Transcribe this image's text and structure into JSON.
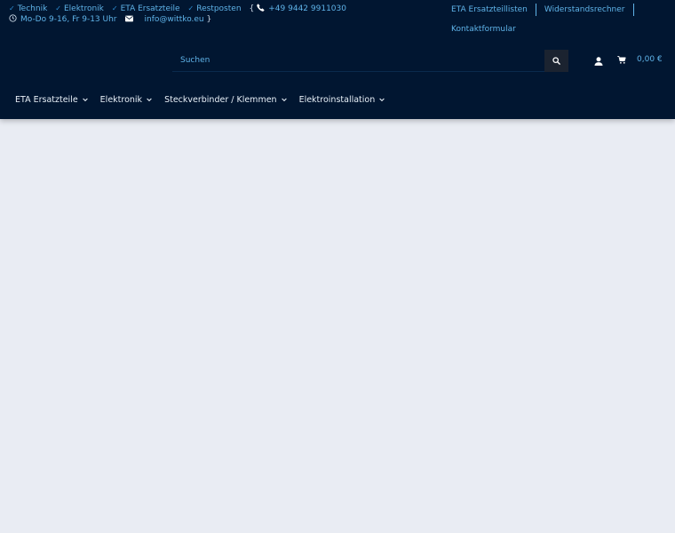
{
  "topbar": {
    "features": [
      "Technik",
      "Elektronik",
      "ETA Ersatzteile",
      "Restposten"
    ],
    "bracket_open": "{",
    "phone": "+49 9442 9911030",
    "hours": "Mo-Do 9-16, Fr 9-13 Uhr",
    "email": "info@wittko.eu",
    "bracket_close": "}"
  },
  "toplinks": {
    "items": [
      "ETA Ersatzteillisten",
      "Widerstandsrechner",
      "Kontaktformular"
    ]
  },
  "search": {
    "placeholder": "Suchen"
  },
  "cart": {
    "total": "0,00 €"
  },
  "nav": {
    "items": [
      "ETA Ersatzteile",
      "Elektronik",
      "Steckverbinder / Klemmen",
      "Elektroinstallation"
    ]
  },
  "colors": {
    "header_bg": "#011631",
    "accent": "#5fb3e8",
    "page_bg": "#e9ecf3"
  }
}
